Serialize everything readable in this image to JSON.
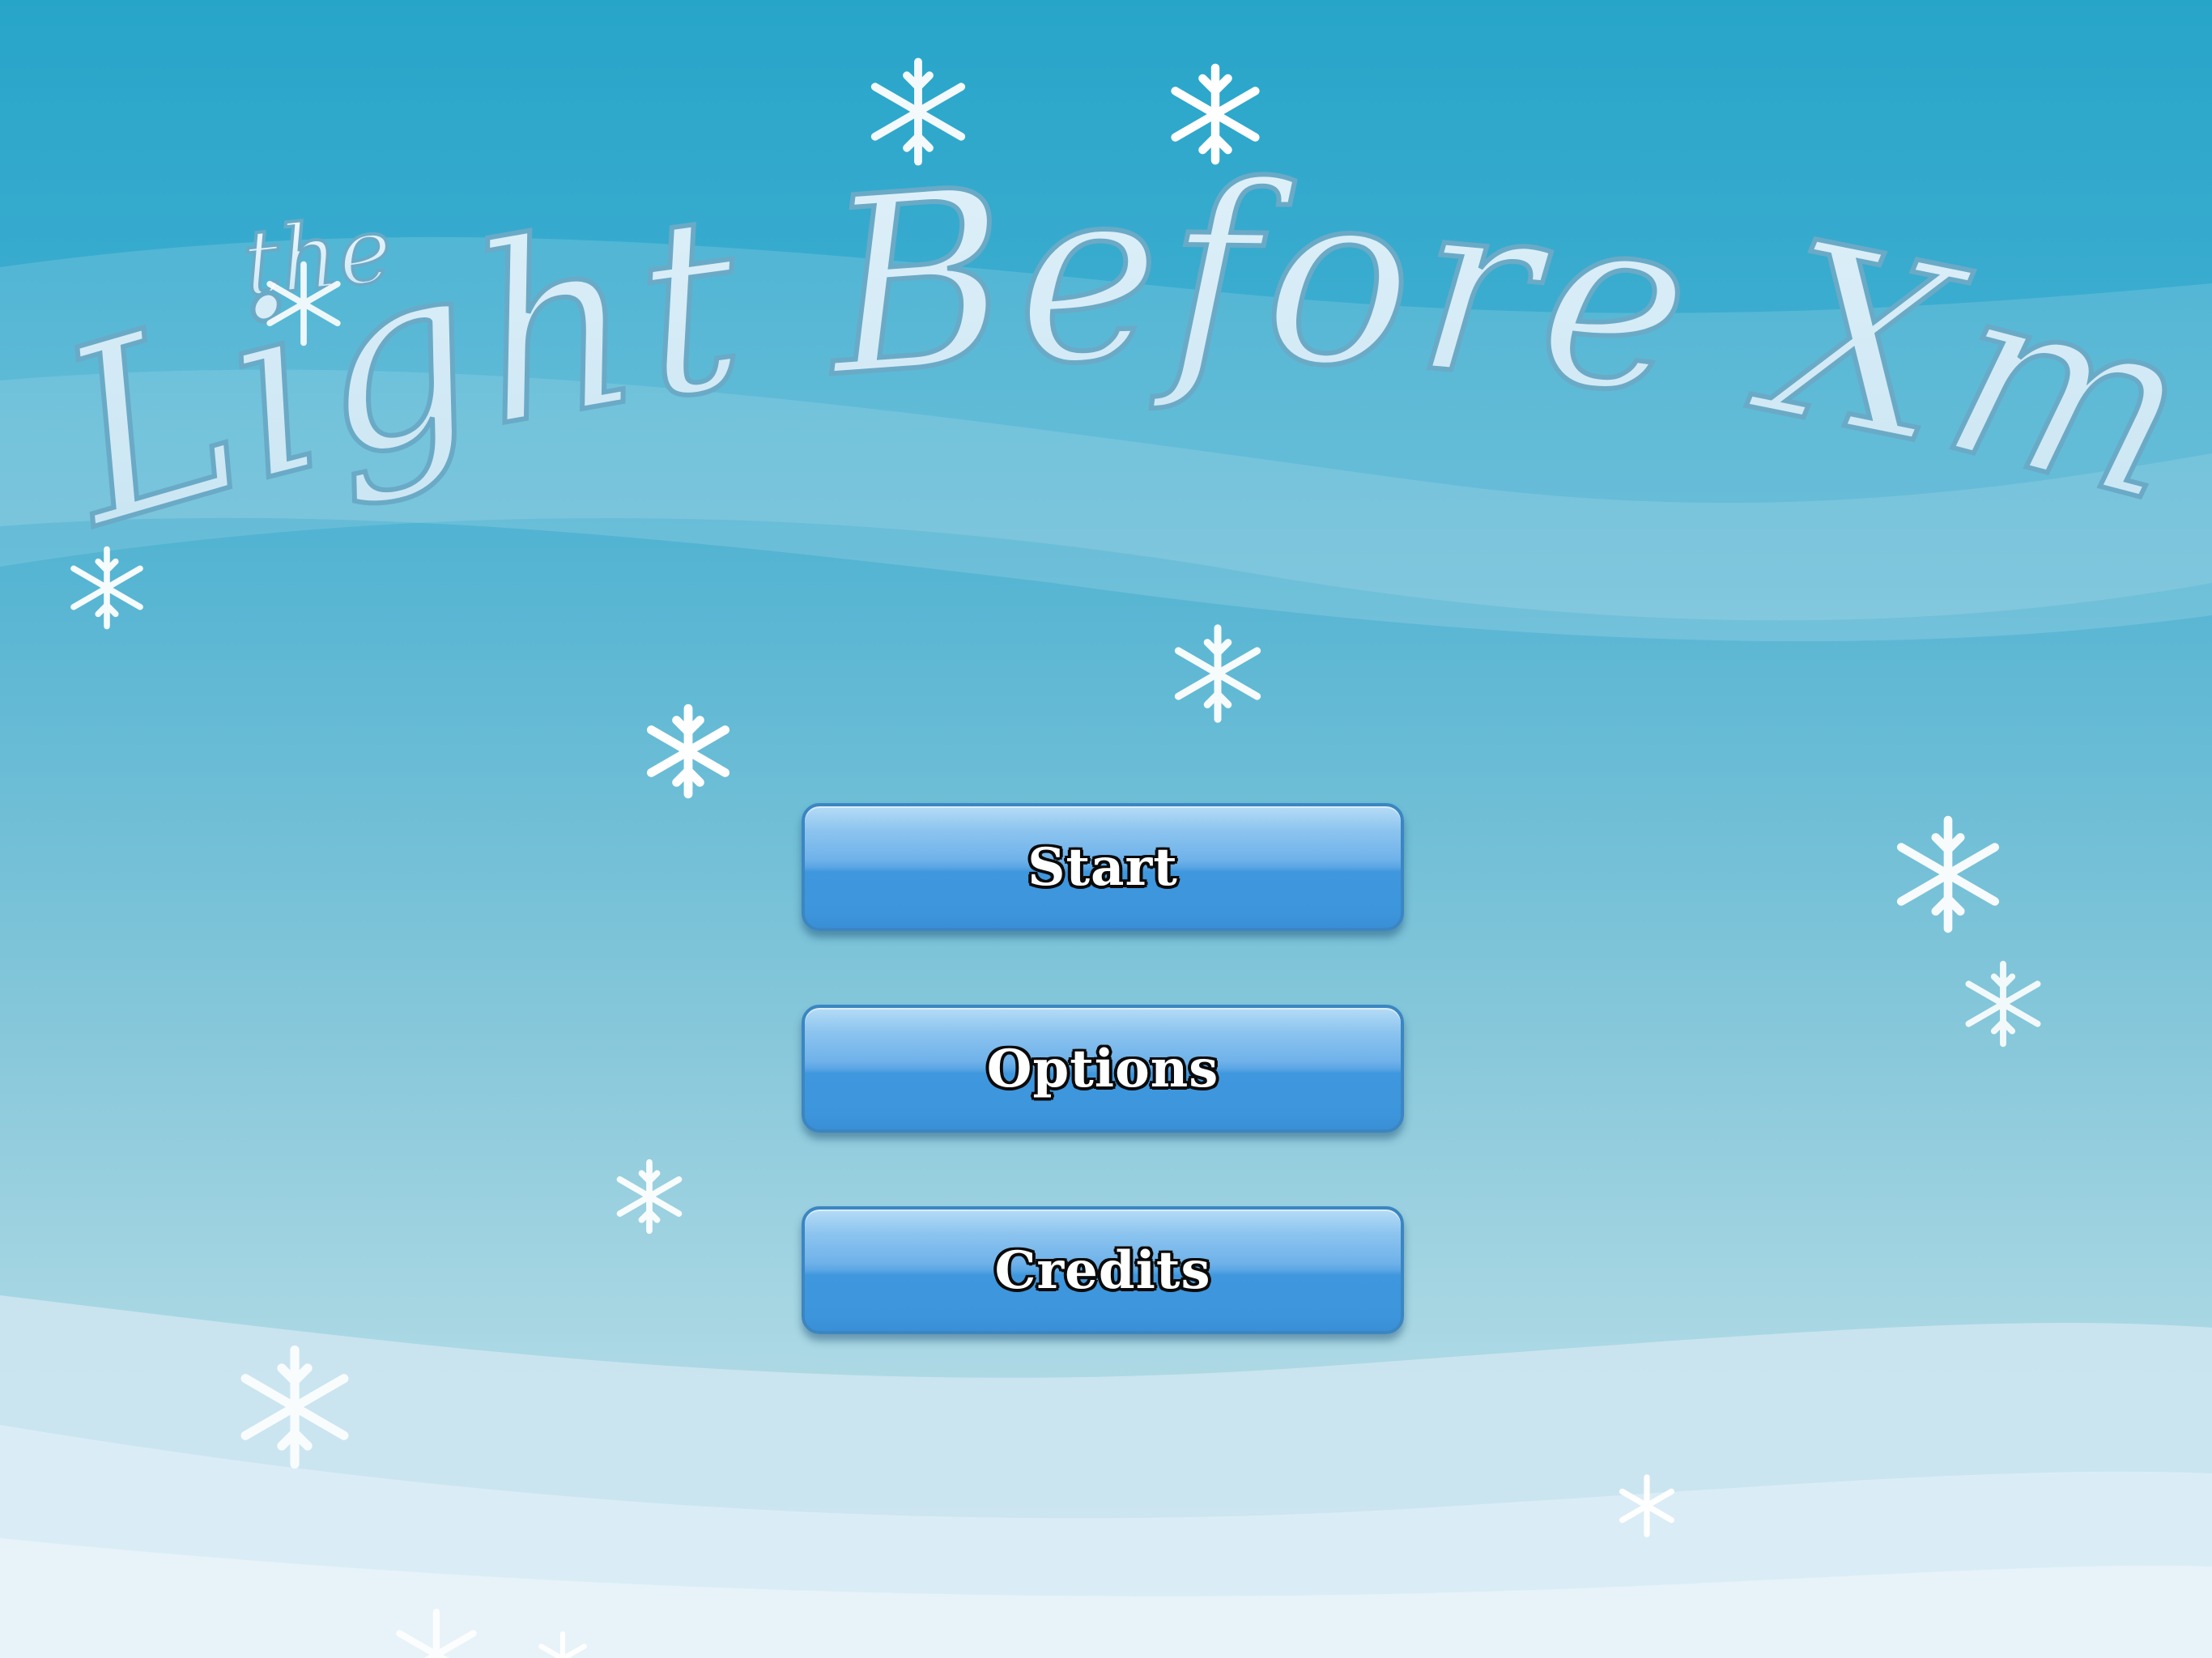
{
  "game": {
    "title_small": "the",
    "title_main": "Light Before Xmas"
  },
  "menu": {
    "start_label": "Start",
    "options_label": "Options",
    "credits_label": "Credits"
  },
  "colors": {
    "sky_top": "#27a5c9",
    "sky_bottom": "#c4e3ee",
    "button_blue": "#3d95dc",
    "title_fill": "#e4f3fa",
    "title_stroke": "#6aaac6"
  },
  "icons": {
    "snowflake": "snowflake-icon"
  }
}
